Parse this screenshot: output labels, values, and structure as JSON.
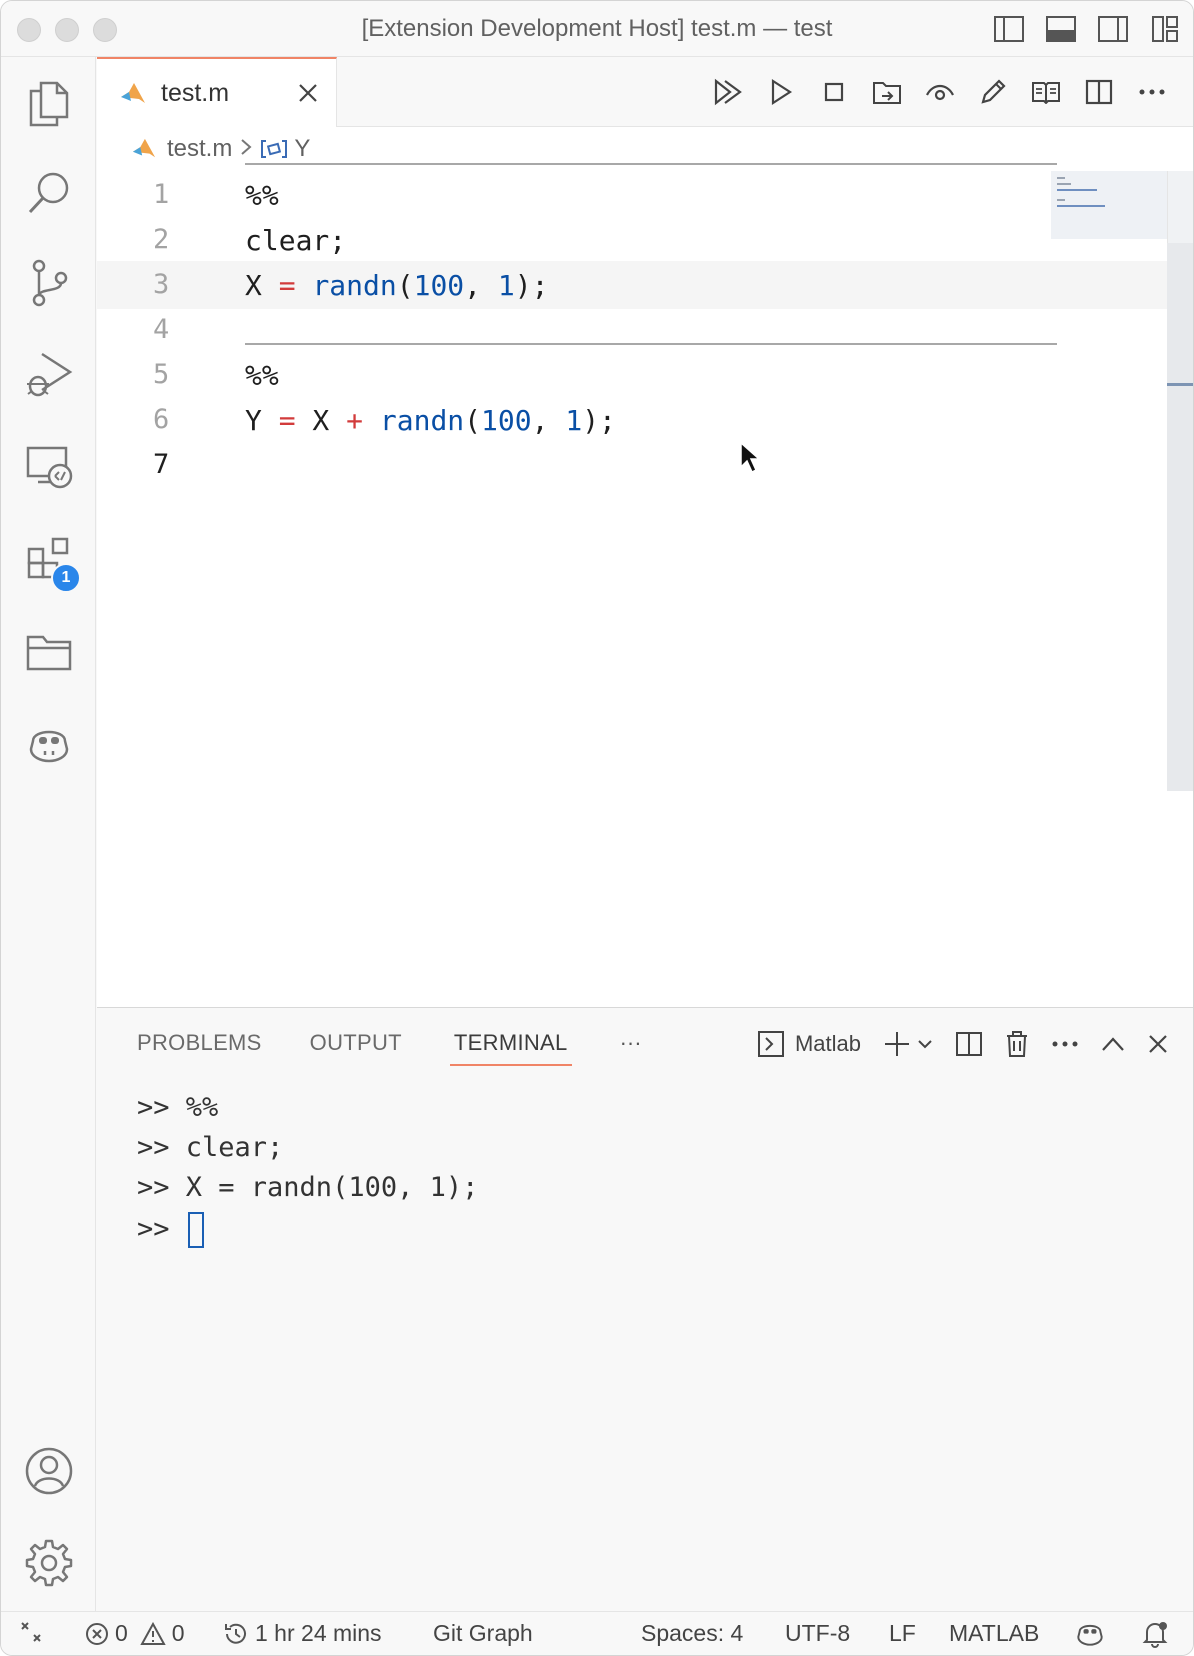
{
  "window": {
    "title": "[Extension Development Host] test.m — test"
  },
  "tabs": [
    {
      "label": "test.m",
      "language": "MATLAB"
    }
  ],
  "breadcrumb": {
    "file": "test.m",
    "symbol": "Y"
  },
  "editor": {
    "lines": [
      {
        "number": "1",
        "text": "%%"
      },
      {
        "number": "2",
        "text": "clear;"
      },
      {
        "number": "3",
        "text": "X = randn(100, 1);"
      },
      {
        "number": "4",
        "text": ""
      },
      {
        "number": "5",
        "text": "%%"
      },
      {
        "number": "6",
        "text": "Y = X + randn(100, 1);"
      },
      {
        "number": "7",
        "text": ""
      }
    ],
    "current_line": "3",
    "active_line_number": "7"
  },
  "activity_bar": {
    "items": [
      {
        "icon": "files-icon"
      },
      {
        "icon": "search-icon"
      },
      {
        "icon": "source-control-icon"
      },
      {
        "icon": "run-debug-icon"
      },
      {
        "icon": "remote-explorer-icon"
      },
      {
        "icon": "extensions-icon",
        "badge": "1"
      },
      {
        "icon": "folder-icon"
      },
      {
        "icon": "copilot-icon"
      }
    ],
    "bottom": [
      {
        "icon": "account-icon"
      },
      {
        "icon": "settings-gear-icon"
      }
    ]
  },
  "panel": {
    "tabs": [
      {
        "label": "PROBLEMS",
        "active": false
      },
      {
        "label": "OUTPUT",
        "active": false
      },
      {
        "label": "TERMINAL",
        "active": true
      }
    ],
    "more_label": "···",
    "terminal_name": "Matlab",
    "terminal_lines": [
      ">> %%",
      ">> clear;",
      ">> X = randn(100, 1);",
      ">> "
    ]
  },
  "statusbar": {
    "errors": "0",
    "warnings": "0",
    "time": "1 hr 24 mins",
    "git_graph": "Git Graph",
    "spaces": "Spaces: 4",
    "encoding": "UTF-8",
    "eol": "LF",
    "language": "MATLAB"
  },
  "colors": {
    "accent_tab": "#f08466",
    "badge": "#2a86ea",
    "keyword_blue": "#0a4fa5",
    "operator_red": "#d23b3b"
  }
}
